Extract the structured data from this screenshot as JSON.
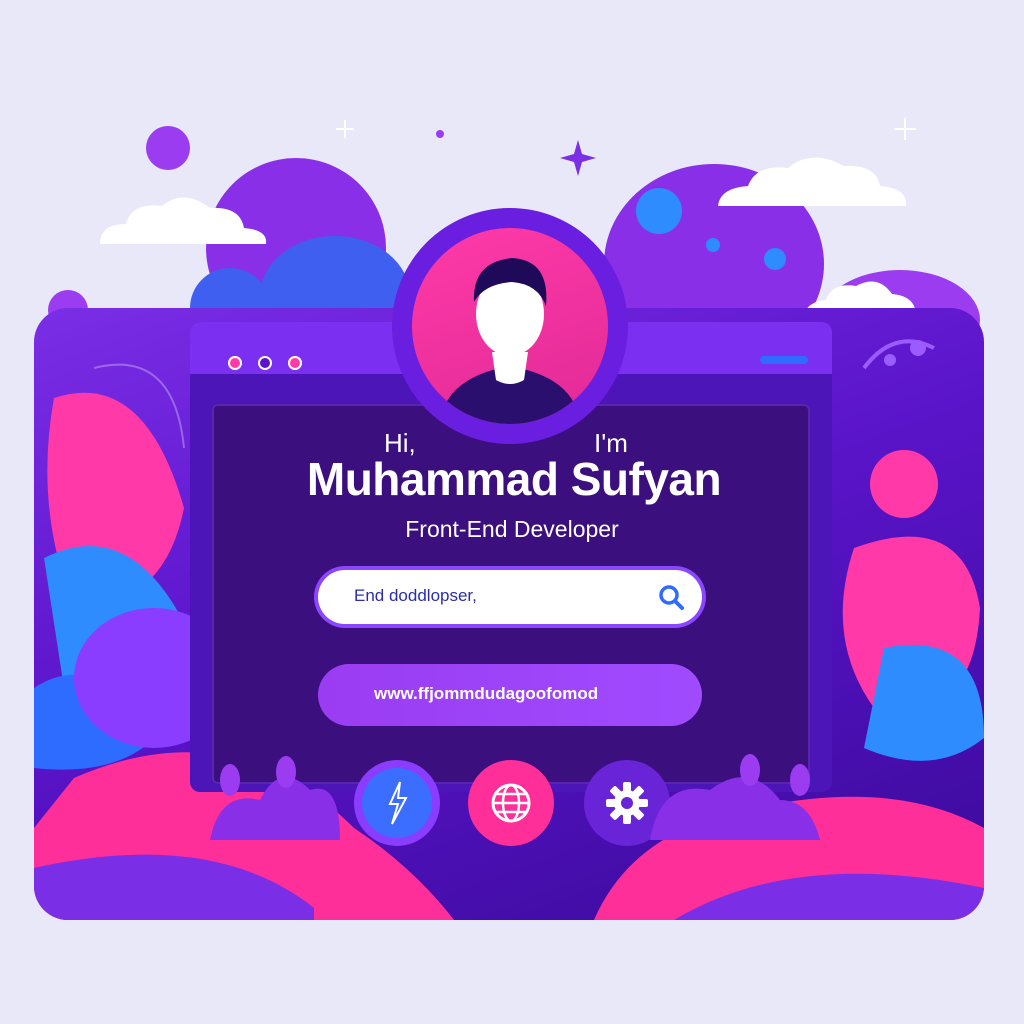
{
  "greeting": {
    "hi": "Hi,",
    "im": "I'm"
  },
  "name": "Muhammad Sufyan",
  "role": "Front-End Developer",
  "search": {
    "value": "End doddlopser,",
    "icon": "search-icon"
  },
  "link_button": {
    "label": "www.ffjommdudagoofomod"
  },
  "window": {
    "controls": [
      "red-dot",
      "purple-dot",
      "pink-dot"
    ]
  },
  "action_buttons": [
    {
      "icon": "lightning-icon",
      "color": "#3b6dff"
    },
    {
      "icon": "globe-icon",
      "color": "#ff2f9a"
    },
    {
      "icon": "gear-icon",
      "color": "#8a3cff"
    }
  ],
  "colors": {
    "background": "#e9e8f8",
    "panel": "#5a14c9",
    "window": "#4b15b8",
    "titlebar": "#7b2ff0",
    "accent_pink": "#ff2f9a",
    "accent_blue": "#3b6dff",
    "accent_purple": "#8a3cff"
  }
}
